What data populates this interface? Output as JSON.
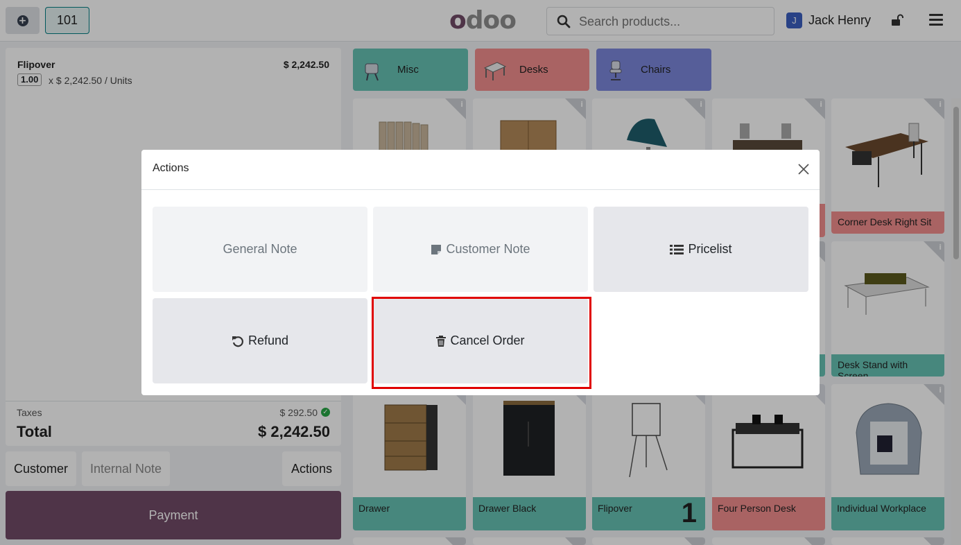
{
  "header": {
    "order_number": "101",
    "logo_text": "odoo",
    "search_placeholder": "Search products...",
    "user_initial": "J",
    "user_name": "Jack Henry"
  },
  "order": {
    "line": {
      "product": "Flipover",
      "price": "$ 2,242.50",
      "qty": "1.00",
      "unit_price": "x $ 2,242.50 / Units"
    },
    "taxes_label": "Taxes",
    "taxes_value": "$ 292.50",
    "total_label": "Total",
    "total_value": "$ 2,242.50"
  },
  "controls": {
    "customer": "Customer",
    "internal_note": "Internal Note",
    "actions": "Actions",
    "payment": "Payment"
  },
  "categories": [
    {
      "label": "Misc",
      "color": "#66c2b3"
    },
    {
      "label": "Desks",
      "color": "#f28f8f"
    },
    {
      "label": "Chairs",
      "color": "#7b87dc"
    }
  ],
  "products": {
    "corner_desk": "Corner Desk Right Sit",
    "desk_stand": "Desk Stand with Screen",
    "drawer": "Drawer",
    "drawer_black": "Drawer Black",
    "flipover": "Flipover",
    "flipover_qty": "1",
    "four_person_desk": "Four Person Desk",
    "individual_workplace": "Individual Workplace"
  },
  "modal": {
    "title": "Actions",
    "buttons": {
      "general_note": "General Note",
      "customer_note": "Customer Note",
      "pricelist": "Pricelist",
      "refund": "Refund",
      "cancel_order": "Cancel Order"
    }
  },
  "colors": {
    "brand": "#714b67",
    "teal_label": "#66c2b3",
    "red_label": "#f28f8f",
    "highlight": "#e00000"
  }
}
